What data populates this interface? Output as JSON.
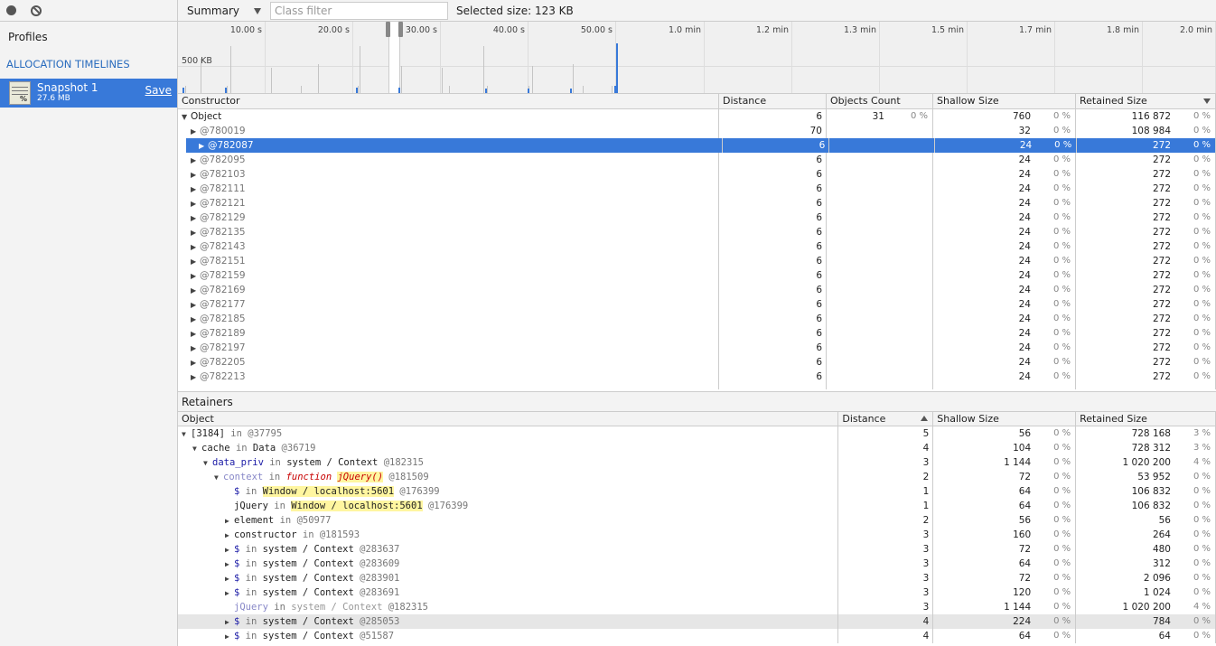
{
  "sidebar": {
    "profiles_label": "Profiles",
    "section_title": "ALLOCATION TIMELINES",
    "snapshot": {
      "name": "Snapshot 1",
      "size": "27.6 MB",
      "save_label": "Save",
      "icon_mark": "%"
    }
  },
  "toolbar": {
    "view": "Summary",
    "filter_placeholder": "Class filter",
    "selected_size": "Selected size: 123 KB"
  },
  "timeline": {
    "ticks": [
      "10.00 s",
      "20.00 s",
      "30.00 s",
      "40.00 s",
      "50.00 s",
      "1.0 min",
      "1.2 min",
      "1.3 min",
      "1.5 min",
      "1.7 min",
      "1.8 min",
      "2.0 min"
    ],
    "scale_label": "500 KB"
  },
  "summary": {
    "columns": [
      "Constructor",
      "Distance",
      "Objects Count",
      "Shallow Size",
      "Retained Size"
    ],
    "group": {
      "name": "Object",
      "distance": "6",
      "count": "31",
      "count_pct": "0 %",
      "shallow": "760",
      "shallow_pct": "0 %",
      "retained": "116 872",
      "retained_pct": "0 %"
    },
    "rows": [
      {
        "id": "@780019",
        "distance": "70",
        "shallow": "32",
        "shallow_pct": "0 %",
        "retained": "108 984",
        "retained_pct": "0 %"
      },
      {
        "id": "@782087",
        "distance": "6",
        "shallow": "24",
        "shallow_pct": "0 %",
        "retained": "272",
        "retained_pct": "0 %"
      },
      {
        "id": "@782095",
        "distance": "6",
        "shallow": "24",
        "shallow_pct": "0 %",
        "retained": "272",
        "retained_pct": "0 %"
      },
      {
        "id": "@782103",
        "distance": "6",
        "shallow": "24",
        "shallow_pct": "0 %",
        "retained": "272",
        "retained_pct": "0 %"
      },
      {
        "id": "@782111",
        "distance": "6",
        "shallow": "24",
        "shallow_pct": "0 %",
        "retained": "272",
        "retained_pct": "0 %"
      },
      {
        "id": "@782121",
        "distance": "6",
        "shallow": "24",
        "shallow_pct": "0 %",
        "retained": "272",
        "retained_pct": "0 %"
      },
      {
        "id": "@782129",
        "distance": "6",
        "shallow": "24",
        "shallow_pct": "0 %",
        "retained": "272",
        "retained_pct": "0 %"
      },
      {
        "id": "@782135",
        "distance": "6",
        "shallow": "24",
        "shallow_pct": "0 %",
        "retained": "272",
        "retained_pct": "0 %"
      },
      {
        "id": "@782143",
        "distance": "6",
        "shallow": "24",
        "shallow_pct": "0 %",
        "retained": "272",
        "retained_pct": "0 %"
      },
      {
        "id": "@782151",
        "distance": "6",
        "shallow": "24",
        "shallow_pct": "0 %",
        "retained": "272",
        "retained_pct": "0 %"
      },
      {
        "id": "@782159",
        "distance": "6",
        "shallow": "24",
        "shallow_pct": "0 %",
        "retained": "272",
        "retained_pct": "0 %"
      },
      {
        "id": "@782169",
        "distance": "6",
        "shallow": "24",
        "shallow_pct": "0 %",
        "retained": "272",
        "retained_pct": "0 %"
      },
      {
        "id": "@782177",
        "distance": "6",
        "shallow": "24",
        "shallow_pct": "0 %",
        "retained": "272",
        "retained_pct": "0 %"
      },
      {
        "id": "@782185",
        "distance": "6",
        "shallow": "24",
        "shallow_pct": "0 %",
        "retained": "272",
        "retained_pct": "0 %"
      },
      {
        "id": "@782189",
        "distance": "6",
        "shallow": "24",
        "shallow_pct": "0 %",
        "retained": "272",
        "retained_pct": "0 %"
      },
      {
        "id": "@782197",
        "distance": "6",
        "shallow": "24",
        "shallow_pct": "0 %",
        "retained": "272",
        "retained_pct": "0 %"
      },
      {
        "id": "@782205",
        "distance": "6",
        "shallow": "24",
        "shallow_pct": "0 %",
        "retained": "272",
        "retained_pct": "0 %"
      },
      {
        "id": "@782213",
        "distance": "6",
        "shallow": "24",
        "shallow_pct": "0 %",
        "retained": "272",
        "retained_pct": "0 %"
      }
    ]
  },
  "retainers": {
    "title": "Retainers",
    "columns": [
      "Object",
      "Distance",
      "Shallow Size",
      "Retained Size"
    ],
    "rows": [
      {
        "name": "[3184]",
        "in": "in",
        "ctx": "",
        "fn": "",
        "id": "@37795",
        "distance": "5",
        "shallow": "56",
        "shallow_pct": "0 %",
        "retained": "728 168",
        "retained_pct": "3 %"
      },
      {
        "name": "cache",
        "in": "in",
        "ctx": "Data",
        "fn": "",
        "id": "@36719",
        "distance": "4",
        "shallow": "104",
        "shallow_pct": "0 %",
        "retained": "728 312",
        "retained_pct": "3 %"
      },
      {
        "name": "data_priv",
        "in": "in",
        "ctx": "system / Context",
        "fn": "",
        "id": "@182315",
        "distance": "3",
        "shallow": "1 144",
        "shallow_pct": "0 %",
        "retained": "1 020 200",
        "retained_pct": "4 %"
      },
      {
        "name": "context",
        "in": "in",
        "ctx": "",
        "fn": "jQuery()",
        "kw": "function",
        "id": "@181509",
        "distance": "2",
        "shallow": "72",
        "shallow_pct": "0 %",
        "retained": "53 952",
        "retained_pct": "0 %"
      },
      {
        "name": "$",
        "in": "in",
        "ctx": "Window / localhost:5601",
        "fn": "",
        "id": "@176399",
        "distance": "1",
        "shallow": "64",
        "shallow_pct": "0 %",
        "retained": "106 832",
        "retained_pct": "0 %"
      },
      {
        "name": "jQuery",
        "in": "in",
        "ctx": "Window / localhost:5601",
        "fn": "",
        "id": "@176399",
        "distance": "1",
        "shallow": "64",
        "shallow_pct": "0 %",
        "retained": "106 832",
        "retained_pct": "0 %"
      },
      {
        "name": "element",
        "in": "in",
        "ctx": "",
        "fn": "",
        "id": "@50977",
        "distance": "2",
        "shallow": "56",
        "shallow_pct": "0 %",
        "retained": "56",
        "retained_pct": "0 %"
      },
      {
        "name": "constructor",
        "in": "in",
        "ctx": "",
        "fn": "",
        "id": "@181593",
        "distance": "3",
        "shallow": "160",
        "shallow_pct": "0 %",
        "retained": "264",
        "retained_pct": "0 %"
      },
      {
        "name": "$",
        "in": "in",
        "ctx": "system / Context",
        "fn": "",
        "id": "@283637",
        "distance": "3",
        "shallow": "72",
        "shallow_pct": "0 %",
        "retained": "480",
        "retained_pct": "0 %"
      },
      {
        "name": "$",
        "in": "in",
        "ctx": "system / Context",
        "fn": "",
        "id": "@283609",
        "distance": "3",
        "shallow": "64",
        "shallow_pct": "0 %",
        "retained": "312",
        "retained_pct": "0 %"
      },
      {
        "name": "$",
        "in": "in",
        "ctx": "system / Context",
        "fn": "",
        "id": "@283901",
        "distance": "3",
        "shallow": "72",
        "shallow_pct": "0 %",
        "retained": "2 096",
        "retained_pct": "0 %"
      },
      {
        "name": "$",
        "in": "in",
        "ctx": "system / Context",
        "fn": "",
        "id": "@283691",
        "distance": "3",
        "shallow": "120",
        "shallow_pct": "0 %",
        "retained": "1 024",
        "retained_pct": "0 %"
      },
      {
        "name": "jQuery",
        "in": "in",
        "ctx": "system / Context",
        "fn": "",
        "id": "@182315",
        "distance": "3",
        "shallow": "1 144",
        "shallow_pct": "0 %",
        "retained": "1 020 200",
        "retained_pct": "4 %"
      },
      {
        "name": "$",
        "in": "in",
        "ctx": "system / Context",
        "fn": "",
        "id": "@285053",
        "distance": "4",
        "shallow": "224",
        "shallow_pct": "0 %",
        "retained": "784",
        "retained_pct": "0 %"
      },
      {
        "name": "$",
        "in": "in",
        "ctx": "system / Context",
        "fn": "",
        "id": "@51587",
        "distance": "4",
        "shallow": "64",
        "shallow_pct": "0 %",
        "retained": "64",
        "retained_pct": "0 %"
      }
    ]
  }
}
